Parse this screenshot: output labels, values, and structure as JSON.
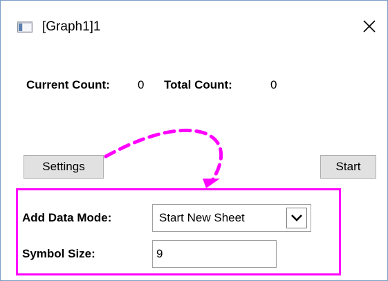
{
  "window": {
    "title": "[Graph1]1",
    "close_glyph": "✕",
    "icon": "window-app-icon"
  },
  "status": {
    "current_count_label": "Current Count:",
    "current_count_value": "0",
    "total_count_label": "Total Count:",
    "total_count_value": "0"
  },
  "buttons": {
    "settings_label": "Settings",
    "start_label": "Start"
  },
  "settings": {
    "add_data_mode_label": "Add Data Mode:",
    "add_data_mode_value": "Start New Sheet",
    "symbol_size_label": "Symbol Size:",
    "symbol_size_value": "9"
  },
  "colors": {
    "annotation": "#ff00ff",
    "button_bg": "#e1e1e1",
    "window_border": "#7a9cc6"
  }
}
